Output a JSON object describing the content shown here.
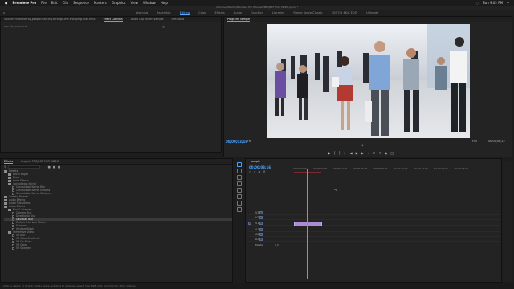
{
  "mac_menu": {
    "apple": "",
    "app_name": "Premiere Pro",
    "items": [
      "File",
      "Edit",
      "Clip",
      "Sequence",
      "Markers",
      "Graphics",
      "View",
      "Window",
      "Help"
    ],
    "clock": "Sun 9:02 PM"
  },
  "window_title": "/Volumes/Maxtor/Premiere Pro Tutorials/PROJECT FOR VIDEO.prproj *",
  "workspaces": {
    "items": [
      "Learning",
      "Assembly",
      "Editing",
      "Color",
      "Effects",
      "Audio",
      "Graphics",
      "Libraries",
      "Frame Serve Classic",
      "EDITOR 4K/8 EDIT",
      "Ultimate"
    ],
    "active_index": 2
  },
  "effect_controls": {
    "tabs": [
      "Source: motionarray-people-walking-through-the-shopping-mall.mp4",
      "Effect Controls",
      "Audio Clip Mixer: sample",
      "Metadata"
    ],
    "active_tab": 1,
    "empty_text": "(no clip selected)"
  },
  "program_monitor": {
    "tab": "Program: sample",
    "timecode_left": "00;00;03;16",
    "fit": "Fit",
    "quality": "Full",
    "timecode_right": "00;00;06;22"
  },
  "effects_panel": {
    "tabs": [
      "Effects",
      "Project: PROJECT FOR VIDEO"
    ],
    "search_placeholder": "",
    "tree": [
      {
        "label": "Presets",
        "kind": "folder",
        "indent": 0
      },
      {
        "label": "Bevel Edges",
        "kind": "folder",
        "indent": 1
      },
      {
        "label": "Blurs",
        "kind": "folder",
        "indent": 1
      },
      {
        "label": "Color Effects",
        "kind": "folder",
        "indent": 1
      },
      {
        "label": "Convolution Kernel",
        "kind": "folder",
        "indent": 1
      },
      {
        "label": "Convolution Kernel Blur",
        "kind": "fx",
        "indent": 2
      },
      {
        "label": "Convolution Kernel Emboss",
        "kind": "fx",
        "indent": 2
      },
      {
        "label": "Convolution Kernel Sharpen",
        "kind": "fx",
        "indent": 2
      },
      {
        "label": "Lumetri Presets",
        "kind": "folder",
        "indent": 0
      },
      {
        "label": "Audio Effects",
        "kind": "folder",
        "indent": 0
      },
      {
        "label": "Audio Transitions",
        "kind": "folder",
        "indent": 0
      },
      {
        "label": "Video Effects",
        "kind": "folder",
        "indent": 0
      },
      {
        "label": "Blur & Sharpen",
        "kind": "folder",
        "indent": 1
      },
      {
        "label": "Camera Blur",
        "kind": "fx",
        "indent": 2
      },
      {
        "label": "Directional Blur",
        "kind": "fx",
        "indent": 2
      },
      {
        "label": "Gaussian Blur",
        "kind": "fx",
        "indent": 2,
        "selected": true
      },
      {
        "label": "Reduce Interlace Flicker",
        "kind": "fx",
        "indent": 2
      },
      {
        "label": "Sharpen",
        "kind": "fx",
        "indent": 2
      },
      {
        "label": "Unsharp Mask",
        "kind": "fx",
        "indent": 2
      },
      {
        "label": "Immersive Video",
        "kind": "folder",
        "indent": 1
      },
      {
        "label": "VR Blur",
        "kind": "fx",
        "indent": 2
      },
      {
        "label": "VR Color Gradients",
        "kind": "fx",
        "indent": 2
      },
      {
        "label": "VR De-Noise",
        "kind": "fx",
        "indent": 2
      },
      {
        "label": "VR Glow",
        "kind": "fx",
        "indent": 2
      },
      {
        "label": "VR Sharpen",
        "kind": "fx",
        "indent": 2
      }
    ]
  },
  "timeline": {
    "tab": "sample",
    "timecode": "00;00;03;16",
    "ruler": [
      "00;00;00;00",
      "00;00;02;00",
      "00;00;04;00",
      "00;00;06;00",
      "00;00;08;00",
      "00;00;10;00",
      "00;00;12;00",
      "00;00;14;00",
      "00;00;16;00"
    ],
    "video_tracks": [
      "V3",
      "V2",
      "V1"
    ],
    "audio_tracks": [
      "A1",
      "A2",
      "A3"
    ],
    "master": "Master",
    "master_value": "0.0"
  },
  "status_bar": "Click to select, or click in empty space and drag to marquee select. Use Shift, Opt, and Cmd for other options.",
  "colors": {
    "accent": "#4aa3ff",
    "clip": "#a98bd6"
  }
}
